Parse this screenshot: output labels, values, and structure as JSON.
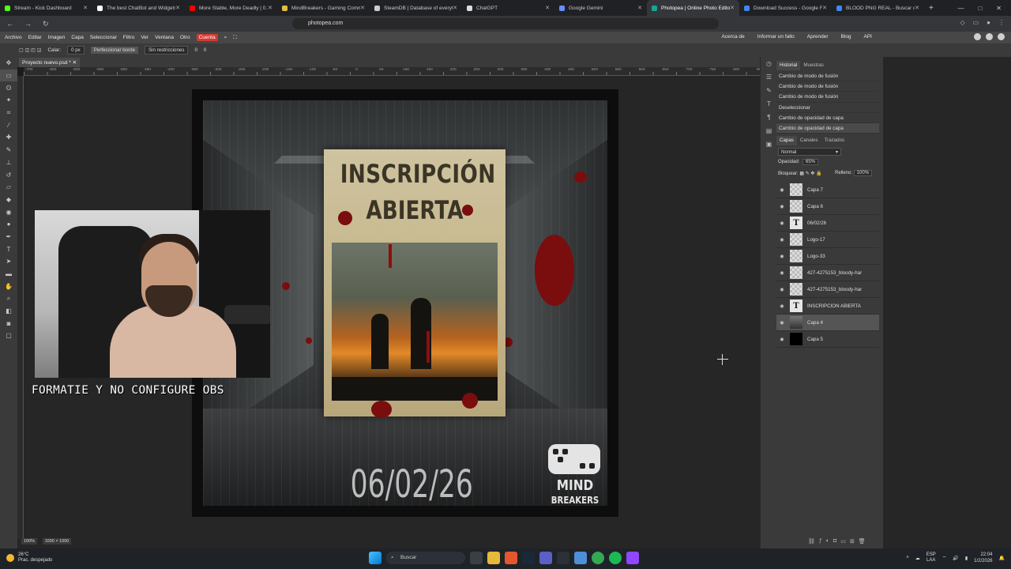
{
  "browser": {
    "tabs": [
      {
        "title": "Stream - Kick Dashboard",
        "color": "#53fc18"
      },
      {
        "title": "The best ChatBot and Widgets for",
        "color": "#ffffff"
      },
      {
        "title": "More Stable, More Deadly | 0.3.5",
        "color": "#ff0000"
      },
      {
        "title": "MindBreakers - Gaming Communit",
        "color": "#e0c040"
      },
      {
        "title": "SteamDB | Database of everything",
        "color": "#cccccc"
      },
      {
        "title": "ChatGPT",
        "color": "#dddddd"
      },
      {
        "title": "Google Gemini",
        "color": "#6a8cff"
      },
      {
        "title": "Photopea | Online Photo Editor",
        "color": "#18a497",
        "active": true
      },
      {
        "title": "Download Success - Google Fonts",
        "color": "#4285f4"
      },
      {
        "title": "BLOOD PNG REAL - Buscar con Go",
        "color": "#4285f4"
      }
    ],
    "url": "photopea.com"
  },
  "menu": {
    "items": [
      "Archivo",
      "Editar",
      "Imagen",
      "Capa",
      "Seleccionar",
      "Filtro",
      "Ver",
      "Ventana",
      "Otro"
    ],
    "account": "Cuenta",
    "links": [
      "Acerca de",
      "Informar un fallo",
      "Aprender",
      "Blog",
      "API"
    ]
  },
  "options": {
    "calar_label": "Calar:",
    "calar_value": "0 px",
    "perfeccionar": "Perfeccionar borde",
    "restriccion": "Sin restricciones",
    "w": "0",
    "h": "0"
  },
  "document": {
    "tab_title": "Proyecto nuevo.psd *",
    "ruler_ticks": [
      "-700",
      "-650",
      "-600",
      "-550",
      "-500",
      "-450",
      "-400",
      "-350",
      "-300",
      "-250",
      "-200",
      "-150",
      "-100",
      "-50",
      "0",
      "50",
      "100",
      "150",
      "200",
      "250",
      "300",
      "350",
      "400",
      "450",
      "500",
      "550",
      "600",
      "650",
      "700",
      "750",
      "800",
      "850"
    ],
    "zoom": "100%",
    "size": "1000 × 1000"
  },
  "poster": {
    "title_line1": "INSCRIPCIÓN",
    "title_line2": "ABIERTA",
    "date": "06/02/26",
    "logo_line1": "MIND",
    "logo_line2": "BREAKERS"
  },
  "overlay": {
    "caption": "FORMATIE Y NO CONFIGURE OBS"
  },
  "panels": {
    "history_tabs": [
      "Historial",
      "Muestras"
    ],
    "history": [
      "Cambio de modo de fusión",
      "Cambio de modo de fusión",
      "Cambio de modo de fusión",
      "Deseleccionar",
      "Cambio de opacidad de capa",
      "Cambio de opacidad de capa"
    ],
    "layer_tabs": [
      "Capas",
      "Canales",
      "Trazados"
    ],
    "blend_mode": "Normal",
    "opacity_label": "Opacidad:",
    "opacity_value": "65%",
    "lock_label": "Bloquear:",
    "fill_label": "Relleno:",
    "fill_value": "100%",
    "layers": [
      {
        "name": "Capa 7",
        "kind": "raster"
      },
      {
        "name": "Capa 6",
        "kind": "raster"
      },
      {
        "name": "06/02/26",
        "kind": "text"
      },
      {
        "name": "Logo-17",
        "kind": "raster"
      },
      {
        "name": "Logo-33",
        "kind": "raster"
      },
      {
        "name": "427-4275153_bloody-har",
        "kind": "raster"
      },
      {
        "name": "427-4275153_bloody-har",
        "kind": "raster"
      },
      {
        "name": "INSCRIPCIÓN ABIERTA",
        "kind": "text"
      },
      {
        "name": "Capa 4",
        "kind": "image",
        "selected": true
      },
      {
        "name": "Capa 5",
        "kind": "black"
      }
    ]
  },
  "taskbar": {
    "temp": "26°C",
    "weather": "Prac. despejado",
    "search": "Buscar",
    "lang1": "ESP",
    "lang2": "LAA",
    "time": "22:04",
    "date": "1/2/2026"
  }
}
